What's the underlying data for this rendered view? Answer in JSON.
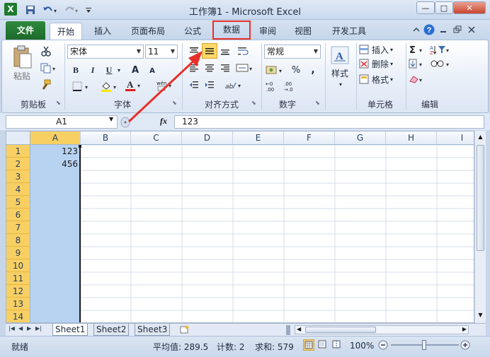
{
  "window": {
    "title": "工作簿1 - Microsoft Excel",
    "app_icon": "X",
    "min_glyph": "—",
    "max_glyph": "□",
    "close_glyph": "✕"
  },
  "tabs": [
    "文件",
    "开始",
    "插入",
    "页面布局",
    "公式",
    "数据",
    "审阅",
    "视图",
    "开发工具"
  ],
  "ribbon": {
    "clipboard": {
      "paste_label": "粘贴",
      "group": "剪贴板"
    },
    "font": {
      "name": "宋体",
      "size": "11",
      "bold": "B",
      "italic": "I",
      "underline": "U",
      "grow": "A",
      "shrink": "A",
      "color_a": "A",
      "wen": "wén",
      "group": "字体"
    },
    "alignment": {
      "group": "对齐方式"
    },
    "number": {
      "format": "常规",
      "percent": "%",
      "comma": ",",
      "group": "数字"
    },
    "styles": {
      "label": "样式"
    },
    "cells": {
      "insert": "插入",
      "delete": "删除",
      "format": "格式",
      "group": "单元格"
    },
    "editing": {
      "group": "编辑"
    }
  },
  "formula_bar": {
    "name_box": "A1",
    "fx": "fx",
    "content": "123"
  },
  "grid": {
    "columns": [
      "A",
      "B",
      "C",
      "D",
      "E",
      "F",
      "G",
      "H",
      "I"
    ],
    "rows": [
      "1",
      "2",
      "3",
      "4",
      "5",
      "6",
      "7",
      "8",
      "9",
      "10",
      "11",
      "12",
      "13",
      "14"
    ],
    "cells": {
      "A1": "123",
      "A2": "456"
    }
  },
  "sheets": [
    "Sheet1",
    "Sheet2",
    "Sheet3"
  ],
  "status": {
    "ready": "就绪",
    "average": "平均值: 289.5",
    "count": "计数: 2",
    "sum": "求和: 579",
    "zoom": "100%"
  },
  "colors": {
    "accent_red": "#e8302b",
    "selection": "#b8d3f2",
    "header_selected": "#f7cf63"
  }
}
